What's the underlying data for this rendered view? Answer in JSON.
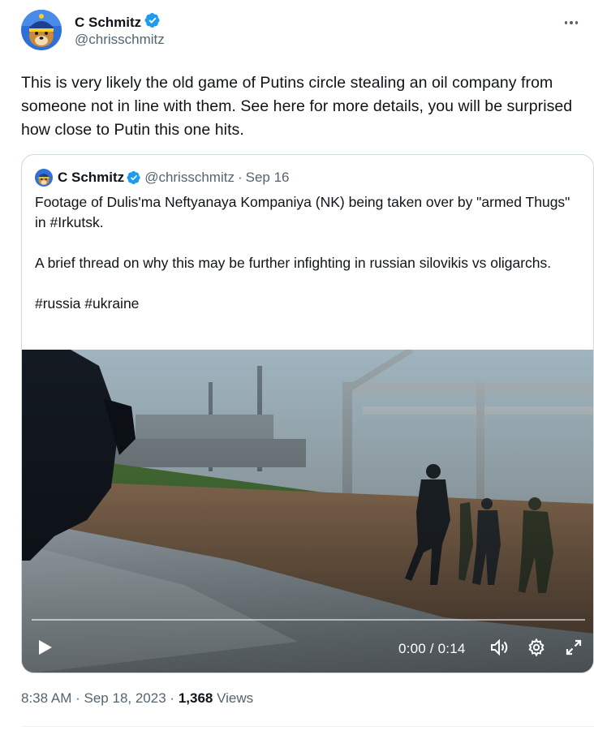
{
  "author": {
    "name": "C Schmitz",
    "handle": "@chrisschmitz",
    "verified": true
  },
  "tweet": {
    "text": "This is very likely the old game of Putins circle stealing an oil company from someone not in line with them. See here for more details, you will be surprised how close to Putin this one hits."
  },
  "quote": {
    "name": "C Schmitz",
    "handle": "@chrisschmitz",
    "separator": "·",
    "date": "Sep 16",
    "paragraphs": [
      "Footage of Dulis'ma Neftyanaya Kompaniya (NK) being taken over by \"armed Thugs\" in #Irkutsk.",
      "A brief thread on why this may be further infighting in russian silovikis vs oligarchs.",
      "#russia #ukraine"
    ],
    "video": {
      "time": "0:00 / 0:14",
      "progress": 0
    }
  },
  "meta": {
    "time": "8:38 AM",
    "sep1": "·",
    "date": "Sep 18, 2023",
    "sep2": "·",
    "views_count": "1,368",
    "views_label": "Views"
  },
  "icons": {
    "more": "more-dots-icon",
    "verified": "verified-badge-icon",
    "play": "play-icon",
    "volume": "volume-icon",
    "settings": "gear-icon",
    "fullscreen": "fullscreen-icon"
  },
  "colors": {
    "verified": "#1d9bf0",
    "secondary_text": "#536471",
    "primary_text": "#0f1419",
    "border": "#cfd9de"
  }
}
